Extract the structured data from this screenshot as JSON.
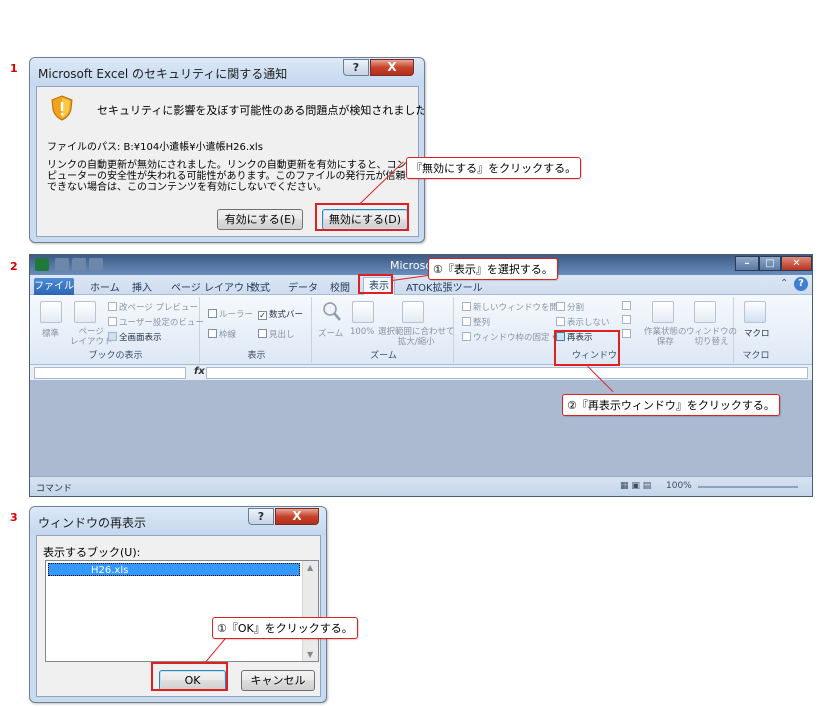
{
  "steps": [
    "1",
    "2",
    "3"
  ],
  "dialog1": {
    "title": "Microsoft Excel のセキュリティに関する通知",
    "help_glyph": "?",
    "close_glyph": "X",
    "warning": "セキュリティに影響を及ぼす可能性のある問題点が検知されました。",
    "file_path": "ファイルのパス:   B:¥104小遣帳¥小遣帳H26.xls",
    "body": "リンクの自動更新が無効にされました。リンクの自動更新を有効にすると、コンピューターの安全性が失われる可能性があります。このファイルの発行元が信頼できない場合は、このコンテンツを有効にしないでください。",
    "enable_button": "有効にする(E)",
    "disable_button": "無効にする(D)",
    "callout": "『無効にする』をクリックする。"
  },
  "excel": {
    "title": "Microsoft",
    "tabs": [
      "ファイル",
      "ホーム",
      "挿入",
      "ページ レイアウト",
      "数式",
      "データ",
      "校閲",
      "表示",
      "ATOK拡張ツール"
    ],
    "active_tab": "表示",
    "groups": {
      "book_view": {
        "label": "ブックの表示",
        "big_items": [
          "標準",
          "ページ\nレイアウト"
        ],
        "items": [
          "改ページ プレビュー",
          "ユーザー設定のビュー",
          "全画面表示"
        ]
      },
      "show": {
        "label": "表示",
        "items": [
          "ルーラー",
          "数式バー",
          "枠線",
          "見出し"
        ],
        "checked": [
          "数式バー"
        ]
      },
      "zoom": {
        "label": "ズーム",
        "items": [
          "ズーム",
          "100%",
          "選択範囲に合わせて\n拡大/縮小"
        ]
      },
      "window": {
        "label": "ウィンドウ",
        "items": [
          "新しいウィンドウを開く",
          "整列",
          "ウィンドウ枠の固定",
          "分割",
          "表示しない",
          "再表示"
        ],
        "big_items": [
          "作業状態の\n保存",
          "ウィンドウの\n切り替え"
        ]
      },
      "macro": {
        "label": "マクロ",
        "items": [
          "マクロ"
        ]
      }
    },
    "formula_fx": "fx",
    "status_mode": "コマンド",
    "zoom_level": "100%",
    "callout1": "①『表示』を選択する。",
    "callout2": "②『再表示ウィンドウ』をクリックする。"
  },
  "dialog3": {
    "title": "ウィンドウの再表示",
    "help_glyph": "?",
    "close_glyph": "X",
    "list_label": "表示するブック(U):",
    "list_items": [
      "H26.xls"
    ],
    "ok_button": "OK",
    "cancel_button": "キャンセル",
    "callout": "①『OK』をクリックする。"
  },
  "colors": {
    "accent_red": "#e02020",
    "title_blue": "#3d5a85",
    "selection_blue": "#3399ff"
  }
}
